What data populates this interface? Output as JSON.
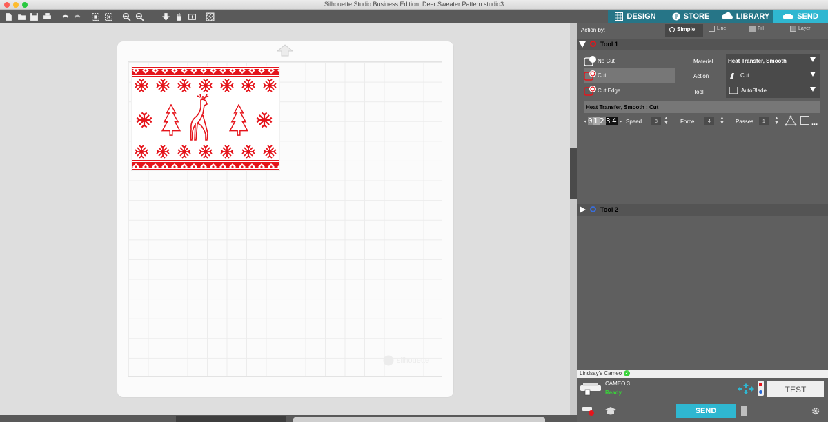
{
  "window": {
    "title": "Silhouette Studio Business Edition: Deer Sweater Pattern.studio3"
  },
  "tabs": [
    {
      "label": "DESIGN",
      "icon": "design-icon"
    },
    {
      "label": "STORE",
      "icon": "store-icon"
    },
    {
      "label": "LIBRARY",
      "icon": "cloud-icon"
    },
    {
      "label": "SEND",
      "icon": "cameo-icon"
    }
  ],
  "toolbar_icons": [
    "new-file-icon",
    "open-folder-icon",
    "save-icon",
    "print-icon",
    "undo-icon",
    "redo-icon",
    "select-all-icon",
    "deselect-icon",
    "zoom-in-icon",
    "zoom-out-icon",
    "zoom-fit-icon",
    "pan-hand-icon",
    "fit-to-page-icon",
    "pattern-fill-icon"
  ],
  "canvas": {
    "watermark": "silhouette"
  },
  "panel": {
    "action_by_label": "Action by:",
    "action_modes": [
      "Simple",
      "Line",
      "Fill",
      "Layer"
    ],
    "tool1": {
      "label": "Tool 1",
      "actions": [
        "No Cut",
        "Cut",
        "Cut Edge"
      ],
      "material_label": "Material",
      "material_value": "Heat Transfer, Smooth",
      "action_label": "Action",
      "action_value": "Cut",
      "tool_label": "Tool",
      "tool_value": "AutoBlade",
      "summary": "Heat Transfer, Smooth : Cut",
      "blade_digits": [
        "0",
        "1",
        "2",
        "3",
        "4"
      ],
      "speed_label": "Speed",
      "speed_value": "8",
      "force_label": "Force",
      "force_value": "4",
      "passes_label": "Passes",
      "passes_value": "1",
      "more": "..."
    },
    "tool2": {
      "label": "Tool 2"
    },
    "device": {
      "name": "Lindsay's Cameo",
      "model": "CAMEO 3",
      "status": "Ready",
      "test_label": "TEST",
      "send_label": "SEND"
    }
  },
  "colors": {
    "accent": "#2fb7d1",
    "design_red": "#e5141b",
    "panel_bg": "#5f5f5f",
    "ready_green": "#39d33a"
  }
}
